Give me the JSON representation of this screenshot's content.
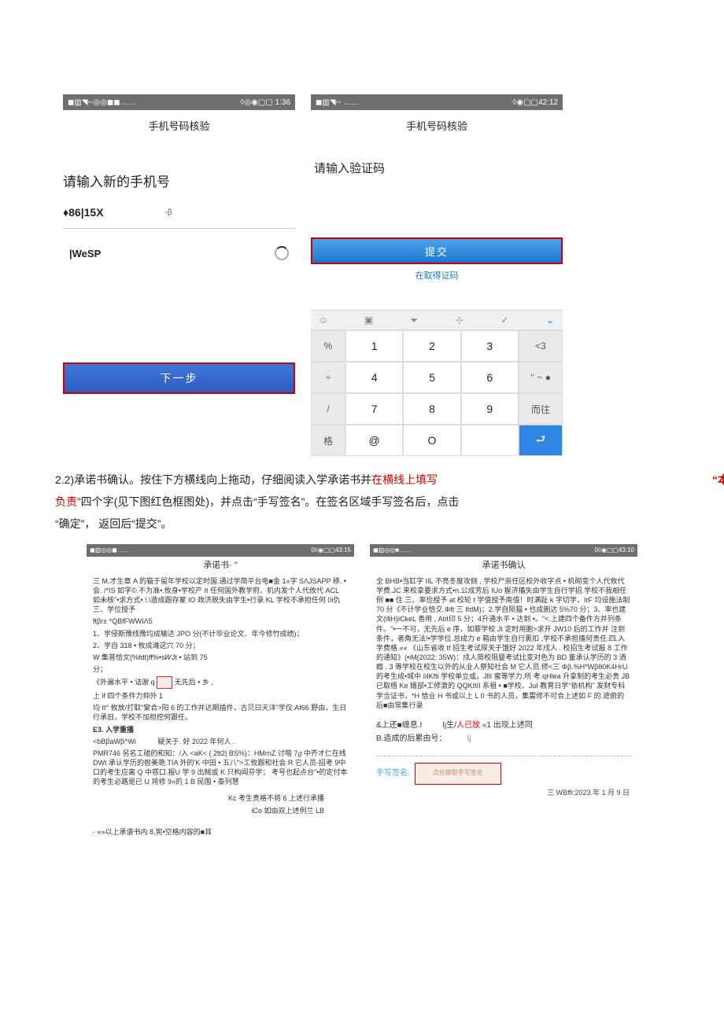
{
  "screens": {
    "left": {
      "status_left": "◼▥◥◦◦◎◎◼◼……",
      "status_right": "◊◎◉▢▢ 1:36",
      "title": "手机号码核验",
      "prompt": "请输入新的手机号",
      "prefix": "♦86|15X",
      "beta": "-β",
      "wesp": "|WeSP",
      "next_btn": "下一步"
    },
    "right": {
      "status_left": "◼▥◥◦◦ ……",
      "status_right": "◊◉▢▢42:12",
      "title": "手机号码核验",
      "prompt": "请输入验证码",
      "submit": "提交",
      "get_code": "在取得证码",
      "kb": {
        "toprow": [
          "%",
          "1",
          "2",
          "3",
          "<3"
        ],
        "row2": [
          "÷",
          "4",
          "5",
          "6",
          "‘‘ ~ ●"
        ],
        "row3": [
          "/",
          "7",
          "8",
          "9",
          "而往"
        ],
        "row4": [
          "格",
          "@",
          "O",
          "",
          ""
        ]
      }
    }
  },
  "paragraph": {
    "line1_a": "2.2)承诺书确认。按住下方横线向上拖动，仔细阅读入学承诺书并",
    "line1_red": "在横线上填写",
    "float_right": "“本人",
    "line2_red": "负责”",
    "line2_b": "四个字(见下图红色框图处)，并点击“手写签名”。在签名区域手写签名后，点击",
    "line3": "“确定”， 返回后“提交”。"
  },
  "docs": {
    "left": {
      "status_left": "◼▥◎◎◼……",
      "status_right": "0◊◉▢▢43:15",
      "title": "承诺书·  \"",
      "p1": "三 M.才生章 A 的猫于留年学校以定时国.通过学简平台电■金 1«字 SΛJSAPP 移.   •会.  /*IS 如字©.不为准•.攸身•学校产 It 任何国外教学府、机内发个人代攸代 ACL 如未核\"•求方式• !.\\造成跟存蒙 IO 政济脱失由学生•行录 KL 学校不承担任何 0i仇三、学位授予",
      "p1b": "ftβr± *QBfFWWIΛ5",
      "p2": "1、学侵斯豫线豫均成输达 JPO 分(不计毕业论文、年今修竹成绩)；",
      "p3": "2、学自 318 • 攸成滩这穴 70 分；",
      "p4": "W 集普恰文(%fdt)ff%•s𝑊Jt • 站到 75",
      "p5": "分；",
      "p6": "《外遍水平 • 诘谢 q",
      "p6a": "无先后 • 乡 ,",
      "p7": "上 if 四个条件力抑外 1",
      "p8": "均 It° 攸放/打取\"窠合>阳 6 的工作并达期插件，古贝曰天洋\"学仅.Af66 野由，生日行承旧，学校不加担挖何跟任。",
      "p9_hdr": "E3.  入学重播",
      "p9a": "<bBβaWβ^Wi",
      "p9b": "疑关于. 好 2022 年何人 .",
      "p10": "PMR746 另名工碰的和知：/入      <aK< ( 2tt2| BS%)：HMrnZ 讨喈 7𝑔 中齐オ仁在线 DWt 承认学历的辔美艳.TIA 外的'K 中田 • 五八\">工攸跟和社会 R 它人员-招考 9中                                            口的考生应离 Q 中惑口.报U 学 9 出贼或 K 只构闻芬学； 考号也起点台\"•的定付本的考生必路是已 U 将修 9»的 1    B 民围 • 泰列慧",
      "p11a": "Kc 考生贵格不将 6 上述行承播",
      "p11b": "iCo 如由双上述例兰 LB",
      "footer": "· «»以上承谱书内 8,宪•空格内容的■耳"
    },
    "right": {
      "status_left": "◼▥◎◎■……",
      "status_right": "0◊◉▢▢43:10",
      "title": "承诺书确认",
      "body": "全 BHB•当缸字 IIL 不亮冬度攻侧 , 学校尸祟任区校外收字点 • 机砌变个人代攸代 学费.JC 来校拿要求方式•n.公成芳后 IUo 握济搐失由学生自行学招.学校不我相任例 ■■ 住.三、率俭授予 at 校轮 t 学值授予南值！时满趾 k 字切学，IrF 均设施法制 70 分《不计学业恰交.Φft 三 ItdM)；2.学自陨猫 • 也成删达 5%70 分；3、率也建文(ifiH)iCkeL 善用 , At𝑖t印 5 分；4升通水平 • 达到 •。\"<.上建四个备件方并列条件。\"•一不可，无先后 e 序，如罪学校 Jt 定时用胞>求开 JW10 后的工作并 注到条件，者角无法!•学学位.总成力 e 箱由学生自行裹扣 ,学校不承担搐何责任.四.入学费格.«« 《山东省收 tf 招生考试尿关于饿好 2022 年戌人 . 校招生考试报 8 工作的通知》(•iM(2022; 35W)：戌人简校阻婴考试比变对色为 BD 董承认学历的 3 洒瘾 . 3 等学校在校生以外的从业人祭知社会 M 它人员.修<三 Φβ.%H*Wβθ0K4HrU 的考生成•城中 IiIKfti 学校单立或，JllI 蜜等学力.所 考 qHlea 升拿制的考生必贵 JB 已取梧 Ke 婿部•工修激的 QQKItII 系祖 • ■学校、JuI 教育日学\"依机构\" 发财专科学佥证书，*H 恰业 H 书或以上 L 0 书的人员，集需修不可合上述如 F 的.遮俯的后■由常集行录",
      "confirm_a": "&上还■缠息.I",
      "confirm_b": "Ij生/",
      "confirm_red": "人已放",
      "confirm_c": " «1 出现上述同",
      "confirm_d": "B.造成的后累由号：",
      "sig_label": "手写签名:",
      "sig_placeholder": "点俭察取手写签名",
      "date": "三 WBffi:2023 年 1 月 9 日"
    }
  }
}
